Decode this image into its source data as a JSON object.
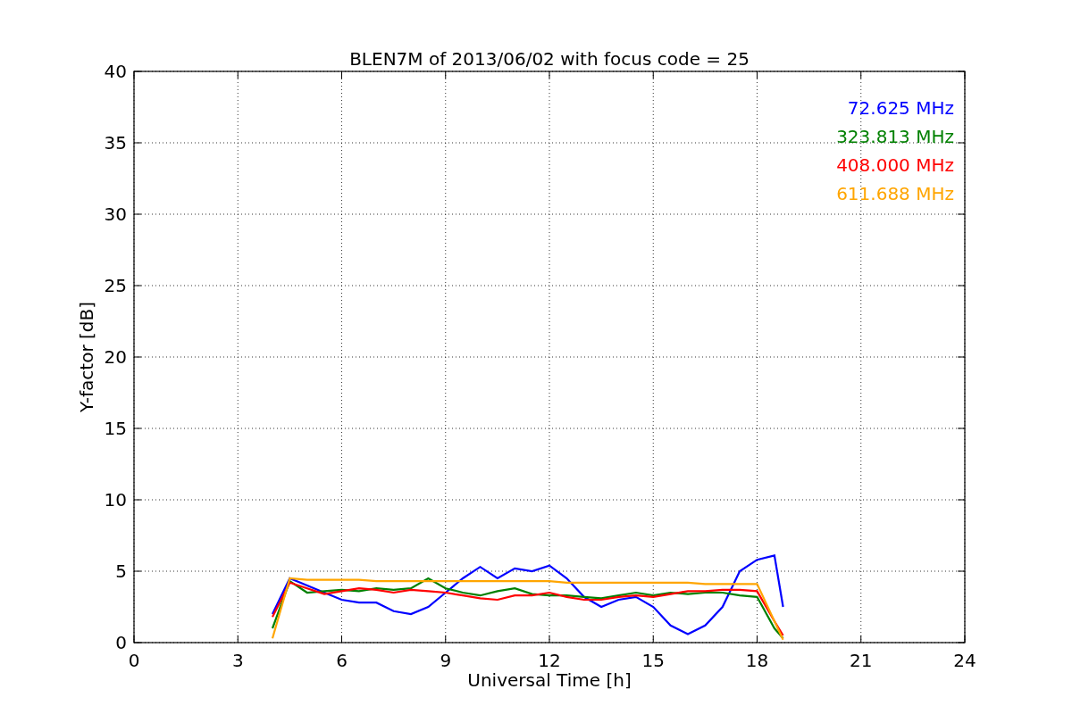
{
  "chart_data": {
    "type": "line",
    "title": "BLEN7M of 2013/06/02 with focus code = 25",
    "xlabel": "Universal Time [h]",
    "ylabel": "Y-factor [dB]",
    "x": [
      4,
      4.5,
      5,
      5.5,
      6,
      6.5,
      7,
      7.5,
      8,
      8.5,
      9,
      9.5,
      10,
      10.5,
      11,
      11.5,
      12,
      12.5,
      13,
      13.5,
      14,
      14.5,
      15,
      15.5,
      16,
      16.5,
      17,
      17.5,
      18,
      18.5,
      18.75
    ],
    "series": [
      {
        "name": "72.625 MHz",
        "color": "#0000ff",
        "values": [
          2.0,
          4.5,
          4.0,
          3.5,
          3.0,
          2.8,
          2.8,
          2.2,
          2.0,
          2.5,
          3.5,
          4.5,
          5.3,
          4.5,
          5.2,
          5.0,
          5.4,
          4.5,
          3.2,
          2.5,
          3.0,
          3.2,
          2.5,
          1.2,
          0.6,
          1.2,
          2.5,
          5.0,
          5.8,
          6.1,
          2.5
        ]
      },
      {
        "name": "323.813 MHz",
        "color": "#008000",
        "values": [
          1.0,
          4.3,
          3.5,
          3.6,
          3.7,
          3.6,
          3.8,
          3.7,
          3.8,
          4.5,
          3.8,
          3.5,
          3.3,
          3.6,
          3.8,
          3.4,
          3.3,
          3.3,
          3.2,
          3.1,
          3.3,
          3.5,
          3.3,
          3.5,
          3.4,
          3.5,
          3.5,
          3.3,
          3.2,
          1.0,
          0.3
        ]
      },
      {
        "name": "408.000 MHz",
        "color": "#ff0000",
        "values": [
          1.8,
          4.2,
          3.8,
          3.4,
          3.6,
          3.8,
          3.7,
          3.5,
          3.7,
          3.6,
          3.5,
          3.3,
          3.1,
          3.0,
          3.3,
          3.3,
          3.5,
          3.2,
          3.0,
          3.0,
          3.2,
          3.3,
          3.2,
          3.4,
          3.6,
          3.6,
          3.7,
          3.7,
          3.6,
          1.5,
          0.5
        ]
      },
      {
        "name": "611.688 MHz",
        "color": "#ffa500",
        "values": [
          0.3,
          4.5,
          4.4,
          4.4,
          4.4,
          4.4,
          4.3,
          4.3,
          4.3,
          4.3,
          4.3,
          4.3,
          4.3,
          4.3,
          4.3,
          4.3,
          4.3,
          4.2,
          4.2,
          4.2,
          4.2,
          4.2,
          4.2,
          4.2,
          4.2,
          4.1,
          4.1,
          4.1,
          4.1,
          1.5,
          0.2
        ]
      }
    ],
    "xlim": [
      0,
      24
    ],
    "ylim": [
      0,
      40
    ],
    "xticks": [
      0,
      3,
      6,
      9,
      12,
      15,
      18,
      21,
      24
    ],
    "yticks": [
      0,
      5,
      10,
      15,
      20,
      25,
      30,
      35,
      40
    ],
    "grid": true
  }
}
